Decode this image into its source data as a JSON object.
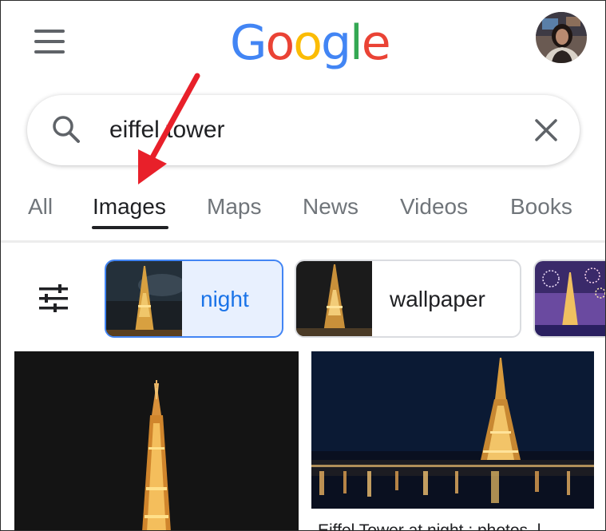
{
  "header": {
    "logo_text": "Google",
    "logo_letters": [
      {
        "ch": "G",
        "color": "#4285F4"
      },
      {
        "ch": "o",
        "color": "#EA4335"
      },
      {
        "ch": "o",
        "color": "#FBBC05"
      },
      {
        "ch": "g",
        "color": "#4285F4"
      },
      {
        "ch": "l",
        "color": "#34A853"
      },
      {
        "ch": "e",
        "color": "#EA4335"
      }
    ],
    "menu_icon": "hamburger-menu-icon",
    "avatar_icon": "user-avatar"
  },
  "search": {
    "query": "eiffel tower",
    "search_icon": "search-icon",
    "clear_icon": "close-icon"
  },
  "tabs": [
    {
      "label": "All",
      "active": false
    },
    {
      "label": "Images",
      "active": true
    },
    {
      "label": "Maps",
      "active": false
    },
    {
      "label": "News",
      "active": false
    },
    {
      "label": "Videos",
      "active": false
    },
    {
      "label": "Books",
      "active": false
    }
  ],
  "filters": {
    "filter_icon": "tune-icon",
    "chips": [
      {
        "label": "night",
        "selected": true
      },
      {
        "label": "wallpaper",
        "selected": false
      },
      {
        "label": "",
        "selected": false
      }
    ]
  },
  "results": [
    {
      "caption": ""
    },
    {
      "caption": "Eiffel Tower at night : photos, l"
    }
  ],
  "annotation": {
    "arrow_color": "#E8202A"
  },
  "colors": {
    "accent": "#1a73e8",
    "chip_selected_bg": "#e8f0fe",
    "text_primary": "#202124",
    "text_secondary": "#70757a"
  }
}
